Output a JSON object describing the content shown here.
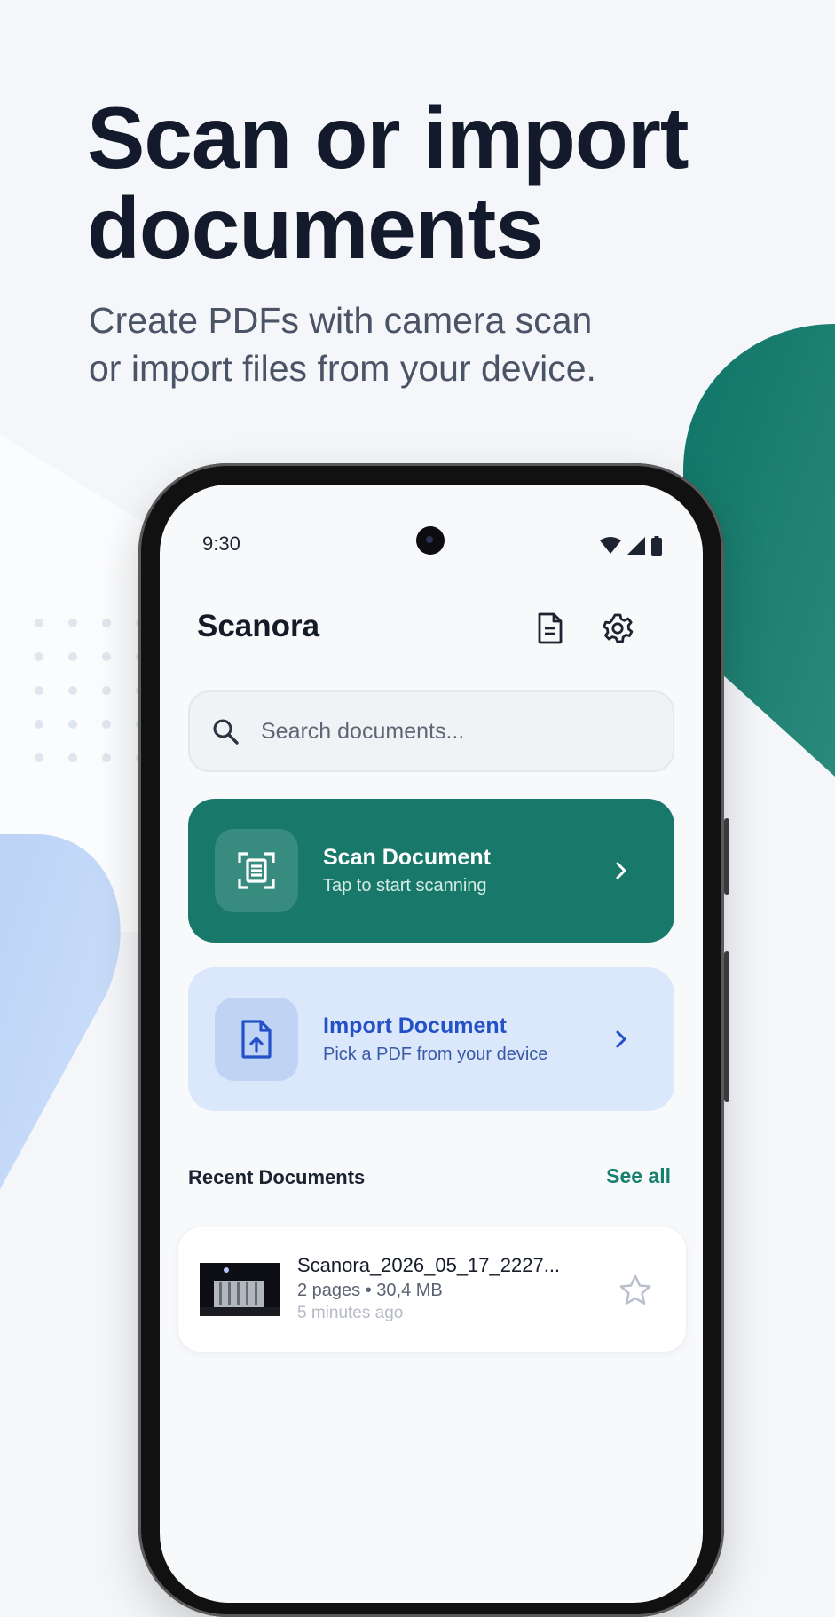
{
  "hero": {
    "title_line1": "Scan or import",
    "title_line2": "documents",
    "subtitle_line1": "Create PDFs with camera scan",
    "subtitle_line2": "or import files from your device."
  },
  "status_bar": {
    "time": "9:30"
  },
  "app": {
    "title": "Scanora",
    "search": {
      "placeholder": "Search documents...",
      "value": ""
    }
  },
  "actions": {
    "scan": {
      "title": "Scan Document",
      "subtitle": "Tap to start scanning"
    },
    "import": {
      "title": "Import Document",
      "subtitle": "Pick a PDF from your device"
    }
  },
  "recent": {
    "title": "Recent Documents",
    "see_all": "See all",
    "items": [
      {
        "name": "Scanora_2026_05_17_2227...",
        "meta": "2 pages • 30,4 MB",
        "time": "5 minutes ago"
      }
    ]
  },
  "colors": {
    "brand_teal": "#18796a",
    "import_blue": "#2450c8",
    "import_bg": "#dbe7fb",
    "hero_text": "#121a2b"
  }
}
